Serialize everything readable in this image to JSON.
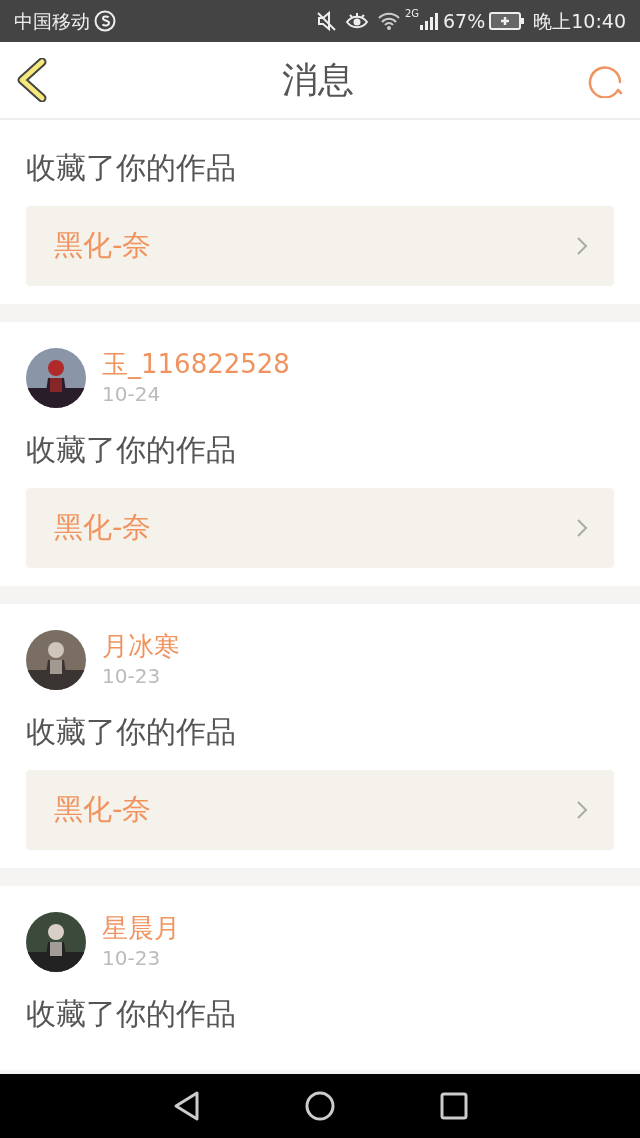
{
  "status_bar": {
    "carrier": "中国移动",
    "network": "2G",
    "battery": "67%",
    "time": "晚上10:40"
  },
  "header": {
    "title": "消息"
  },
  "messages": [
    {
      "action": "收藏了你的作品",
      "work": "黑化-奈"
    },
    {
      "user": {
        "name": "玉_116822528",
        "date": "10-24"
      },
      "action": "收藏了你的作品",
      "work": "黑化-奈"
    },
    {
      "user": {
        "name": "月冰寒",
        "date": "10-23"
      },
      "action": "收藏了你的作品",
      "work": "黑化-奈"
    },
    {
      "user": {
        "name": "星晨月",
        "date": "10-23"
      },
      "action": "收藏了你的作品"
    }
  ]
}
